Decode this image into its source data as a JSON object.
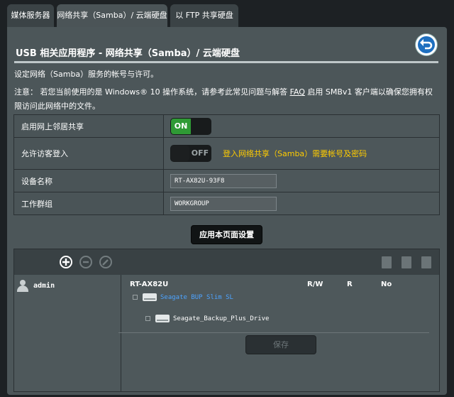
{
  "tabs": [
    {
      "label": "媒体服务器"
    },
    {
      "label": "网络共享（Samba）/ 云端硬盘"
    },
    {
      "label": "以 FTP 共享硬盘"
    }
  ],
  "page": {
    "title": "USB 相关应用程序 - 网络共享（Samba）/ 云端硬盘",
    "description": "设定网络（Samba）服务的帐号与许可。",
    "note_prefix": "注意：  若您当前使用的是 Windows® 10 操作系统，请参考此常见问题与解答 ",
    "note_link": "FAQ",
    "note_suffix": " 启用 SMBv1 客户端以确保您拥有权限访问此网络中的文件。"
  },
  "settings": {
    "network_neighborhood": {
      "label": "启用网上邻居共享",
      "state": "ON"
    },
    "guest_login": {
      "label": "允许访客登入",
      "state": "OFF",
      "hint": "登入网络共享（Samba）需要帐号及密码"
    },
    "device_name": {
      "label": "设备名称",
      "value": "RT-AX82U-93F8"
    },
    "workgroup": {
      "label": "工作群组",
      "value": "WORKGROUP"
    }
  },
  "apply_label": "应用本页面设置",
  "share": {
    "user": "admin",
    "device": "RT-AX82U",
    "col_rw": "R/W",
    "col_r": "R",
    "col_no": "No",
    "disk": "Seagate BUP Slim SL",
    "folder": "Seagate_Backup_Plus_Drive",
    "save_label": "保存"
  },
  "colors": {
    "accent_on": "#2f9a35",
    "hint": "#ffcc00",
    "link_blue": "#4da3ff"
  }
}
